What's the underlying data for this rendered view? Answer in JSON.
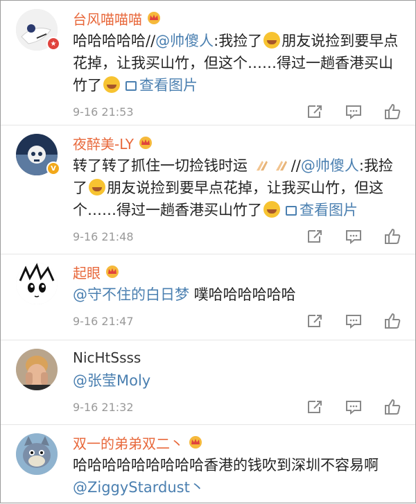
{
  "comments": [
    {
      "username": "台风喵喵喵",
      "segments": {
        "a": "哈哈哈哈哈//",
        "mention": "@帅傻人",
        "b": ":我捡了",
        "c": "朋友说捡到要早点花掉，让我买山竹，但这个……得过一趟香港买山竹了",
        "img": "查看图片"
      },
      "time": "9-16 21:53"
    },
    {
      "username": "夜醉美-LY",
      "segments": {
        "a": "转了转了抓住一切捡钱时运",
        "sep": "//",
        "mention": "@帅傻人",
        "b": ":我捡了",
        "c": "朋友说捡到要早点花掉，让我买山竹，但这个……得过一趟香港买山竹了",
        "img": "查看图片"
      },
      "time": "9-16 21:48"
    },
    {
      "username": "起眼",
      "segments": {
        "mention": "@守不住的白日梦",
        "a": " 噗哈哈哈哈哈哈"
      },
      "time": "9-16 21:47"
    },
    {
      "username": "NicHtSsss",
      "segments": {
        "mention": "@张莹Moly"
      },
      "time": "9-16 21:32"
    },
    {
      "username": "双一的弟弟双二丶",
      "segments": {
        "a": "哈哈哈哈哈哈哈哈哈香港的钱吹到深圳不容易啊",
        "mention": "@ZiggyStardust丶"
      }
    }
  ],
  "icons": {
    "share": "share-icon",
    "reply": "comment-icon",
    "like": "thumbs-up-icon",
    "crown": "vip-crown-icon",
    "picture": "picture-icon"
  },
  "colors": {
    "username": "#e8683b",
    "link": "#4a7fb0",
    "meta": "#999999"
  }
}
